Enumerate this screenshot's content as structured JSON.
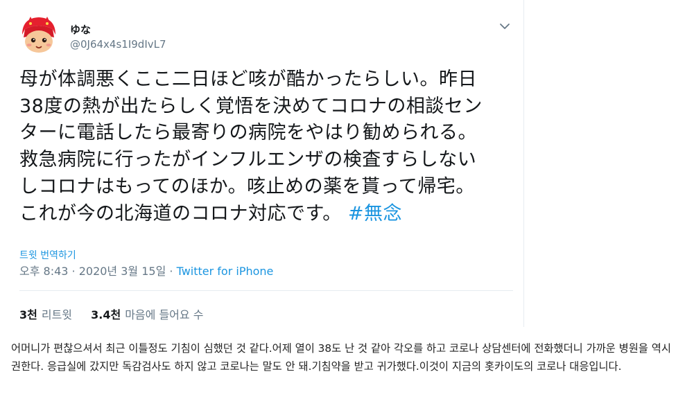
{
  "tweet": {
    "display_name": "ゆな",
    "handle": "@0J64x4s1I9dIvL7",
    "text_lines": [
      "母が体調悪くここ二日ほど咳が酷かったらしい。昨日",
      "38度の熱が出たらしく覚悟を決めてコロナの相談セン",
      "ターに電話したら最寄りの病院をやはり勧められる。",
      "救急病院に行ったがインフルエンザの検査すらしない",
      "しコロナはもってのほか。咳止めの薬を貰って帰宅。",
      "これが今の北海道のコロナ対応です。"
    ],
    "hashtag": "#無念",
    "translate_label": "트윗 번역하기",
    "timestamp": "오후 8:43 · 2020년 3월 15일",
    "separator": " · ",
    "source": "Twitter for iPhone",
    "retweets_count": "3천",
    "retweets_label": "리트윗",
    "likes_count": "3.4천",
    "likes_label": "마음에 들어요 수",
    "colors": {
      "link": "#1b95e0",
      "secondary": "#657786",
      "avatar_red": "#e5202e",
      "avatar_skin": "#f6c79a"
    },
    "icons": {
      "avatar": "anime-character-avatar",
      "caret": "chevron-down-icon"
    }
  },
  "translation": {
    "text": "어머니가 편찮으셔서 최근 이틀정도 기침이 심했던 것 같다.어제 열이 38도 난 것 같아 각오를 하고 코로나 상담센터에 전화했더니 가까운 병원을 역시 권한다. 응급실에 갔지만 독감검사도 하지 않고 코로나는 말도 안 돼.기침약을 받고 귀가했다.이것이 지금의 홋카이도의 코로나 대응입니다."
  }
}
